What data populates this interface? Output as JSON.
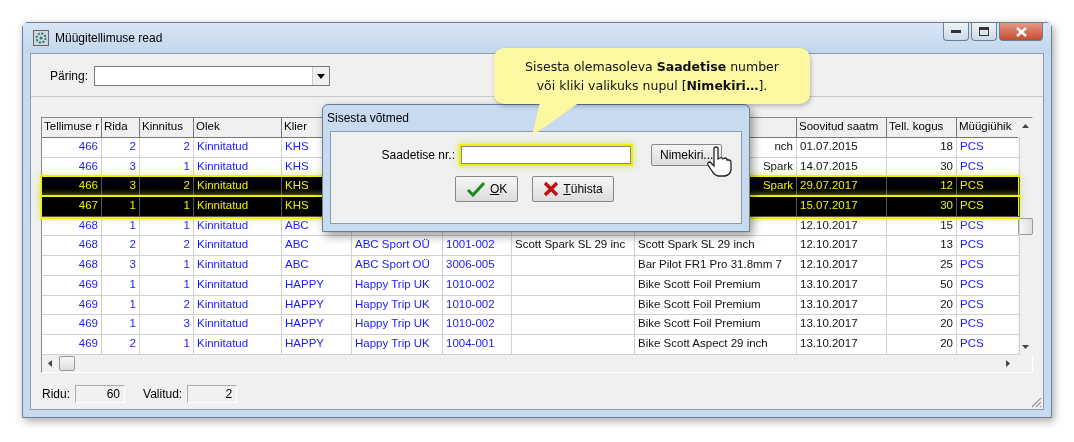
{
  "window": {
    "title": "Müügitellimuse read"
  },
  "query": {
    "label": "Päring:"
  },
  "table": {
    "columns": [
      "Tellimuse r",
      "Rida",
      "Kinnitus",
      "Olek",
      "Klier",
      null,
      null,
      null,
      null,
      "Soovitud saatm",
      "Tell. kogus",
      "Müügiühik"
    ],
    "rows": [
      {
        "selected": false,
        "cells": [
          "466",
          "2",
          "2",
          "Kinnitatud",
          "KHS",
          null,
          null,
          null,
          "nch",
          "01.07.2015",
          "18",
          "PCS"
        ]
      },
      {
        "selected": false,
        "cells": [
          "466",
          "3",
          "1",
          "Kinnitatud",
          "KHS",
          null,
          null,
          null,
          "Spark",
          "14.07.2015",
          "30",
          "PCS"
        ]
      },
      {
        "selected": true,
        "cells": [
          "466",
          "3",
          "2",
          "Kinnitatud",
          "KHS",
          null,
          null,
          null,
          "Spark",
          "29.07.2017",
          "12",
          "PCS"
        ]
      },
      {
        "selected": true,
        "cells": [
          "467",
          "1",
          "1",
          "Kinnitatud",
          "KHS",
          null,
          null,
          null,
          null,
          "15.07.2017",
          "30",
          "PCS"
        ]
      },
      {
        "selected": false,
        "cells": [
          "468",
          "1",
          "1",
          "Kinnitatud",
          "ABC",
          null,
          null,
          null,
          null,
          "12.10.2017",
          "15",
          "PCS"
        ]
      },
      {
        "selected": false,
        "cells": [
          "468",
          "2",
          "2",
          "Kinnitatud",
          "ABC",
          "ABC Sport OÜ",
          "1001-002",
          "Scott Spark SL 29 inc",
          "Scott Spark SL 29 inch",
          "12.10.2017",
          "13",
          "PCS"
        ]
      },
      {
        "selected": false,
        "cells": [
          "468",
          "3",
          "1",
          "Kinnitatud",
          "ABC",
          "ABC Sport OÜ",
          "3006-005",
          null,
          "Bar Pilot FR1 Pro 31.8mm 7",
          "12.10.2017",
          "25",
          "PCS"
        ]
      },
      {
        "selected": false,
        "cells": [
          "469",
          "1",
          "1",
          "Kinnitatud",
          "HAPPY",
          "Happy Trip UK",
          "1010-002",
          null,
          "Bike Scott Foil Premium",
          "13.10.2017",
          "50",
          "PCS"
        ]
      },
      {
        "selected": false,
        "cells": [
          "469",
          "1",
          "2",
          "Kinnitatud",
          "HAPPY",
          "Happy Trip UK",
          "1010-002",
          null,
          "Bike Scott Foil Premium",
          "13.10.2017",
          "20",
          "PCS"
        ]
      },
      {
        "selected": false,
        "cells": [
          "469",
          "1",
          "3",
          "Kinnitatud",
          "HAPPY",
          "Happy Trip UK",
          "1010-002",
          null,
          "Bike Scott Foil Premium",
          "13.10.2017",
          "20",
          "PCS"
        ]
      },
      {
        "selected": false,
        "cells": [
          "469",
          "2",
          "1",
          "Kinnitatud",
          "HAPPY",
          "Happy Trip UK",
          "1004-001",
          null,
          "Bike Scott Aspect 29 inch",
          "13.10.2017",
          "20",
          "PCS"
        ]
      }
    ]
  },
  "status_bar": [
    {
      "label": "Ridu:",
      "value": "60"
    },
    {
      "label": "Valitud:",
      "value": "2"
    }
  ],
  "dialog": {
    "title": "Sisesta võtmed",
    "field_label": "Saadetise nr.:",
    "list_button": "Nimekiri...",
    "ok_button": "OK",
    "cancel_button": "Tühista"
  },
  "callout": {
    "text": "Sisesta olemasoleva **Saadetise** number või kliki valikuks nupul [**Nimekiri…**]."
  }
}
